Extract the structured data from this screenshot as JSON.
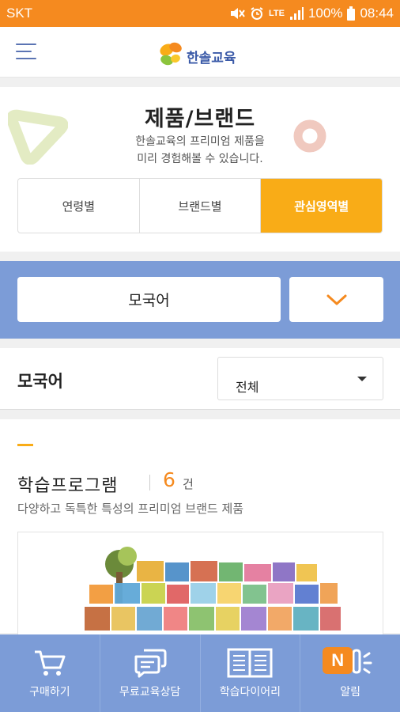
{
  "status_bar": {
    "carrier": "SKT",
    "network": "LTE",
    "battery": "100%",
    "time": "08:44"
  },
  "header": {
    "logo_text": "한솔교육",
    "menu_icon": "hamburger-menu-icon"
  },
  "hero": {
    "title": "제품/브랜드",
    "desc_line1": "한솔교육의 프리미엄 제품을",
    "desc_line2": "미리 경험해볼 수 있습니다."
  },
  "tabs": [
    {
      "label": "연령별",
      "active": false
    },
    {
      "label": "브랜드별",
      "active": false
    },
    {
      "label": "관심영역별",
      "active": true
    }
  ],
  "filter": {
    "selected": "모국어",
    "toggle_icon": "chevron-down-icon"
  },
  "list_header": {
    "title": "모국어",
    "dropdown_value": "전체"
  },
  "section": {
    "title": "학습프로그램",
    "count": "6",
    "unit": "건",
    "description": "다양하고 독특한 특성의 프리미엄 브랜드 제품"
  },
  "bottom_nav": [
    {
      "label": "구매하기",
      "icon": "cart-icon"
    },
    {
      "label": "무료교육상담",
      "icon": "chat-icon"
    },
    {
      "label": "학습다이어리",
      "icon": "book-icon"
    },
    {
      "label": "알림",
      "icon": "bell-icon",
      "badge": "N"
    }
  ],
  "colors": {
    "status_bar": "#f58a1f",
    "accent": "#f9ac17",
    "band": "#7c9cd7",
    "count": "#f58a1f"
  }
}
